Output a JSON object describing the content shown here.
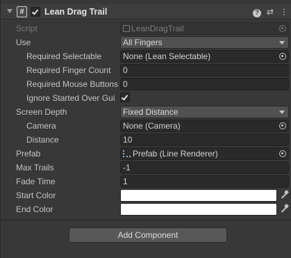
{
  "component": {
    "title": "Lean Drag Trail",
    "enabled": true
  },
  "fields": {
    "script": {
      "label": "Script",
      "value": "LeanDragTrail"
    },
    "use": {
      "label": "Use",
      "value": "All Fingers"
    },
    "required_selectable": {
      "label": "Required Selectable",
      "value": "None (Lean Selectable)"
    },
    "required_finger_count": {
      "label": "Required Finger Count",
      "value": "0"
    },
    "required_mouse_buttons": {
      "label": "Required Mouse Buttons",
      "value": "0"
    },
    "ignore_started_over_gui": {
      "label": "Ignore Started Over Gui",
      "checked": true
    },
    "screen_depth": {
      "label": "Screen Depth",
      "value": "Fixed Distance"
    },
    "camera": {
      "label": "Camera",
      "value": "None (Camera)"
    },
    "distance": {
      "label": "Distance",
      "value": "10"
    },
    "prefab": {
      "label": "Prefab",
      "value": "Prefab (Line Renderer)"
    },
    "max_trails": {
      "label": "Max Trails",
      "value": "-1"
    },
    "fade_time": {
      "label": "Fade Time",
      "value": "1"
    },
    "start_color": {
      "label": "Start Color",
      "color": "#ffffff"
    },
    "end_color": {
      "label": "End Color",
      "color": "#ffffff"
    }
  },
  "footer": {
    "add_component_label": "Add Component"
  },
  "icons": {
    "fold": "chevron-down-icon",
    "script": "script-icon",
    "help": "help-icon",
    "presets": "presets-icon",
    "menu": "kebab-menu-icon",
    "object_picker": "object-picker-icon",
    "eyedropper": "eyedropper-icon"
  }
}
